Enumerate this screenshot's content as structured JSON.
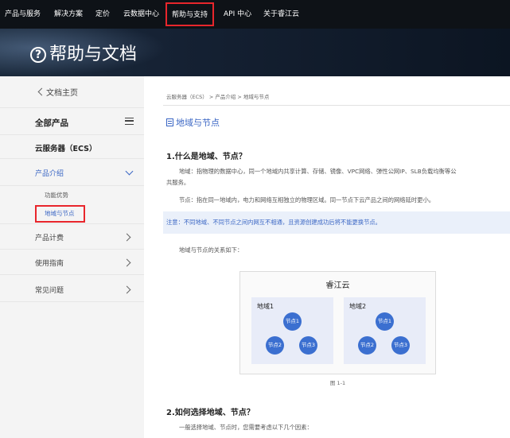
{
  "nav": {
    "items": [
      "产品与服务",
      "解决方案",
      "定价",
      "云数据中心",
      "帮助与支持",
      "API 中心",
      "关于睿江云"
    ],
    "active_index": 4
  },
  "banner": {
    "title": "帮助与文档",
    "icon": "question-circle-icon"
  },
  "sidebar": {
    "back": "文档主页",
    "all_products": "全部产品",
    "product": "云服务器（ECS）",
    "section_intro": "产品介绍",
    "sub_items": [
      "功能优势",
      "地域与节点"
    ],
    "active_sub_index": 1,
    "sections": [
      "产品计费",
      "使用指南",
      "常见问题"
    ]
  },
  "breadcrumb": "云服务器（ECS） > 产品介绍 > 地域与节点",
  "page_title": "地域与节点",
  "q1": {
    "heading": "1.什么是地域、节点？",
    "p1": "地域：指物理的数据中心，同一个地域内共享计算、存储、镜像、VPC网络、弹性公网IP、SLB负载均衡等公",
    "p1b": "共服务。",
    "p2": "节点：指在同一地域内，电力和网络互相独立的物理区域。同一节点下云产品之间的网络延时更小。",
    "note": "注意：不同地域、不同节点之间内网互不相通，且资源创建成功后将不能更换节点。",
    "relation": "地域与节点的关系如下："
  },
  "diagram": {
    "title": "睿江云",
    "regions": [
      {
        "name": "地域1",
        "nodes": [
          "节点1",
          "节点2",
          "节点3"
        ]
      },
      {
        "name": "地域2",
        "nodes": [
          "节点1",
          "节点2",
          "节点3"
        ]
      }
    ],
    "caption": "图 1-1"
  },
  "q2": {
    "heading": "2.如何选择地域、节点？",
    "p1": "一般选择地域、节点时，您需要考虑以下几个因素："
  },
  "colors": {
    "accent": "#3a66c4",
    "highlight": "#e8262c",
    "nav_bg": "#0e1217",
    "node": "#3b6fd0"
  }
}
